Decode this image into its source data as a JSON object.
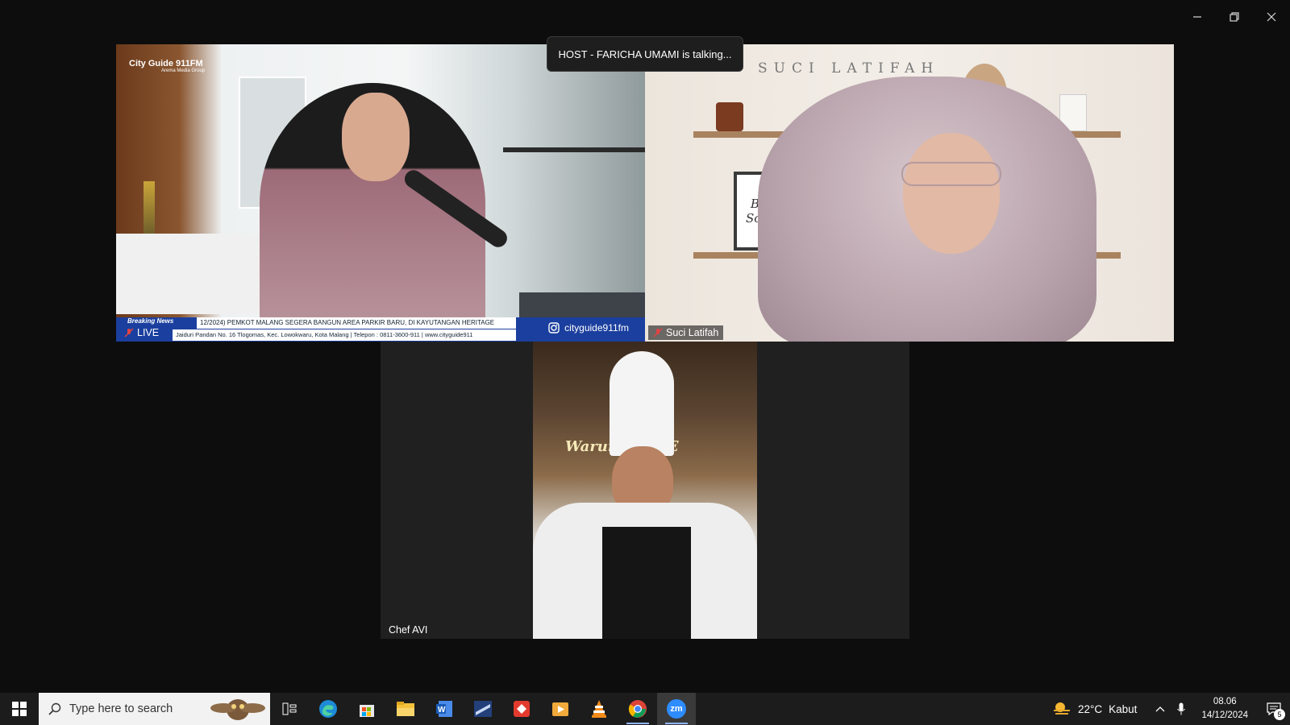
{
  "meeting": {
    "talking_banner": "HOST - FARICHA UMAMI is talking...",
    "participants": [
      {
        "name": "",
        "role": "host",
        "muted": true,
        "tag": "LIVE"
      },
      {
        "name": "Suci Latifah",
        "muted": true
      },
      {
        "name": "Chef AVI",
        "muted": false
      }
    ]
  },
  "host_video": {
    "brand": "City Guide 911FM",
    "brand_sub": "Arema Media Group",
    "breaking_label": "Breaking News",
    "ticker_headline": "12/2024) PEMKOT MALANG SEGERA BANGUN AREA PARKIR BARU, DI KAYUTANGAN HERITAGE",
    "ticker_address": "Jaiduri Pandan No. 16 Tlogomas, Kec. Lowokwaru, Kota Malang | Telepon : 0811-3600-911 | www.cityguide911",
    "instagram": "cityguide911fm",
    "live_label": "LIVE"
  },
  "guest_video": {
    "watermark": "SUCI LATIFAH",
    "frame_text": "Brigitte Schwartz"
  },
  "chef_video": {
    "sign_text": "Warung KASE"
  },
  "taskbar": {
    "search_placeholder": "Type here to search",
    "apps": [
      "task-view",
      "edge",
      "store",
      "file-explorer",
      "word",
      "app-blue",
      "app-red",
      "media-player",
      "vlc",
      "chrome",
      "zoom"
    ],
    "zoom_label": "zm",
    "weather_temp": "22°C",
    "weather_desc": "Kabut",
    "time": "08.06",
    "date": "14/12/2024",
    "notification_count": "5"
  },
  "colors": {
    "accent": "#8fb4ff",
    "zoom": "#2d8cff",
    "ticker": "#1b3f9e"
  }
}
